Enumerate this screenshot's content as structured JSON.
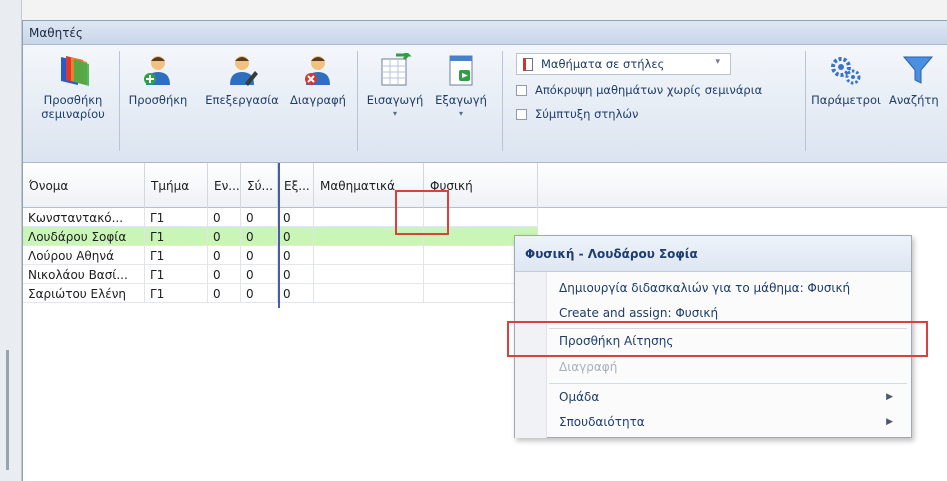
{
  "window": {
    "title": "Μαθητές"
  },
  "ribbon": {
    "buttons": [
      {
        "label": "Προσθήκη\nσεμιναρίου",
        "icon": "add-seminar-icon"
      },
      {
        "label": "Προσθήκη",
        "icon": "add-user-icon"
      },
      {
        "label": "Επεξεργασία",
        "icon": "edit-user-icon"
      },
      {
        "label": "Διαγραφή",
        "icon": "delete-user-icon"
      },
      {
        "label": "Εισαγωγή",
        "icon": "import-icon"
      },
      {
        "label": "Εξαγωγή",
        "icon": "export-icon"
      },
      {
        "label": "Παράμετροι",
        "icon": "gears-icon"
      },
      {
        "label": "Αναζήτη",
        "icon": "filter-icon"
      }
    ],
    "view_combo": "Μαθήματα σε στήλες",
    "hide_option": "Απόκρυψη μαθημάτων χωρίς σεμινάρια",
    "collapse_option": "Σύμπτυξη στηλών"
  },
  "grid": {
    "columns": [
      "Όνομα",
      "Τμήμα",
      "Εν...",
      "Σύ...",
      "Εξ...",
      "Μαθηματικά",
      "Φυσική"
    ],
    "rows": [
      [
        "Κωνσταντακό...",
        "Γ1",
        "0",
        "0",
        "0",
        "",
        ""
      ],
      [
        "Λουδάρου Σοφία",
        "Γ1",
        "0",
        "0",
        "0",
        "",
        ""
      ],
      [
        "Λούρου Αθηνά",
        "Γ1",
        "0",
        "0",
        "0",
        "",
        ""
      ],
      [
        "Νικολάου Βασί...",
        "Γ1",
        "0",
        "0",
        "0",
        "",
        ""
      ],
      [
        "Σαριώτου Ελένη",
        "Γ1",
        "0",
        "0",
        "0",
        "",
        ""
      ]
    ],
    "selected_row": 1
  },
  "context_menu": {
    "title": "Φυσική - Λουδάρου Σοφία",
    "items": [
      {
        "label": "Δημιουργία διδασκαλιών για το μάθημα: Φυσική",
        "enabled": true
      },
      {
        "label": "Create and assign:  Φυσική",
        "enabled": true
      },
      {
        "label": "Προσθήκη Αίτησης",
        "enabled": true
      },
      {
        "label": "Διαγραφή",
        "enabled": false
      },
      {
        "label": "Ομάδα",
        "enabled": true,
        "submenu": true
      },
      {
        "label": "Σπουδαιότητα",
        "enabled": true,
        "submenu": true
      }
    ]
  },
  "colors": {
    "selected_row": "#c9f5b7",
    "highlight_box": "#d9423c",
    "ribbon_text": "#1f3c6b"
  }
}
